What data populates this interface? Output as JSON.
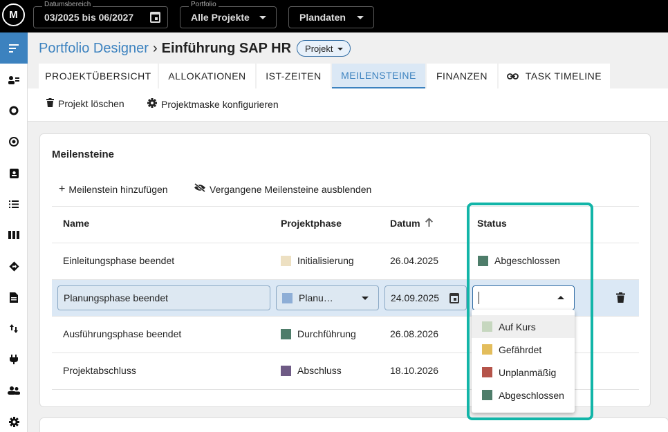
{
  "topbar": {
    "logo": "M",
    "date_range": {
      "label": "Datumsbereich",
      "value": "03/2025 bis 06/2027"
    },
    "portfolio": {
      "label": "Portfolio",
      "value": "Alle Projekte"
    },
    "plandaten": {
      "value": "Plandaten"
    }
  },
  "breadcrumb": {
    "link": "Portfolio Designer",
    "separator": "›",
    "title": "Einführung SAP HR",
    "chip": "Projekt"
  },
  "tabs": [
    {
      "label": "PROJEKTÜBERSICHT"
    },
    {
      "label": "ALLOKATIONEN"
    },
    {
      "label": "IST-ZEITEN"
    },
    {
      "label": "MEILENSTEINE",
      "active": true
    },
    {
      "label": "FINANZEN"
    },
    {
      "label": "TASK TIMELINE",
      "icon": "link-icon"
    }
  ],
  "toolbar": {
    "delete_label": "Projekt löschen",
    "configure_label": "Projektmaske konfigurieren"
  },
  "card": {
    "title": "Meilensteine",
    "add_label": "Meilenstein hinzufügen",
    "hide_label": "Vergangene Meilensteine ausblenden"
  },
  "table": {
    "headers": {
      "name": "Name",
      "phase": "Projektphase",
      "date": "Datum",
      "status": "Status"
    },
    "rows": [
      {
        "name": "Einleitungsphase beendet",
        "phase": "Initialisierung",
        "phase_color": "#ede0c2",
        "date": "26.04.2025",
        "status": "Abgeschlossen",
        "status_color": "#4e7d6a"
      },
      {
        "name": "Planungsphase beendet",
        "phase": "Planu…",
        "phase_color": "#8eaed6",
        "date": "24.09.2025",
        "status": "",
        "editing": true
      },
      {
        "name": "Ausführungsphase beendet",
        "phase": "Durchführung",
        "phase_color": "#4e7d6a",
        "date": "26.08.2026",
        "status": ""
      },
      {
        "name": "Projektabschluss",
        "phase": "Abschluss",
        "phase_color": "#6e5a85",
        "date": "18.10.2026",
        "status": ""
      }
    ]
  },
  "status_options": [
    {
      "label": "Auf Kurs",
      "color": "#c6d7bf"
    },
    {
      "label": "Gefährdet",
      "color": "#e3bd5c"
    },
    {
      "label": "Unplanmäßig",
      "color": "#b5544a"
    },
    {
      "label": "Abgeschlossen",
      "color": "#4e7d6a"
    }
  ],
  "colors": {
    "accent": "#3c82bf",
    "highlight": "#12b5a8"
  }
}
